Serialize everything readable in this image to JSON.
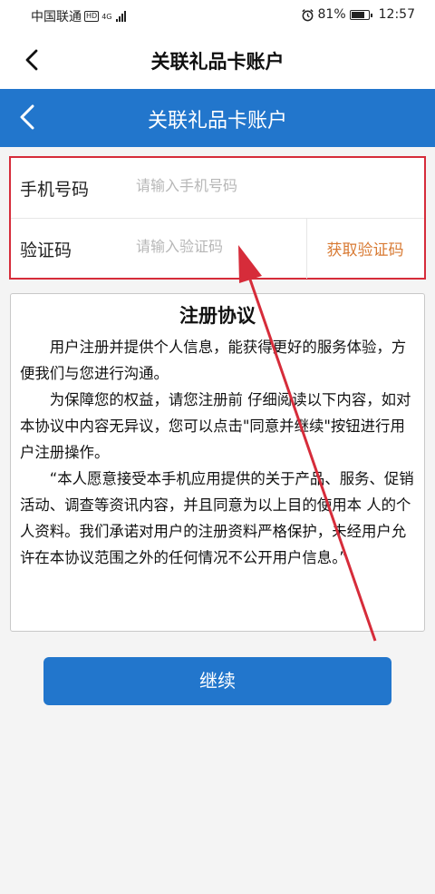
{
  "status_bar": {
    "carrier": "中国联通",
    "hd_badge": "HD",
    "network_type": "4G",
    "alarm_icon": "alarm-clock-icon",
    "battery_percent": "81%",
    "battery_level": 0.81,
    "time": "12:57"
  },
  "app_bar": {
    "title": "关联礼品卡账户",
    "back_icon": "chevron-left-icon"
  },
  "page_header": {
    "title": "关联礼品卡账户",
    "background_color": "#2276cc",
    "back_icon": "chevron-left-icon"
  },
  "form": {
    "phone_label": "手机号码",
    "phone_value": "",
    "phone_placeholder": "请输入手机号码",
    "code_label": "验证码",
    "code_value": "",
    "code_placeholder": "请输入验证码",
    "get_code_label": "获取验证码",
    "highlight_color": "#d62c3a"
  },
  "agreement": {
    "title": "注册协议",
    "paragraphs": [
      "用户注册并提供个人信息，能获得更好的服务体验，方便我们与您进行沟通。",
      "为保障您的权益，请您注册前 仔细阅读以下内容，如对本协议中内容无异议，您可以点击\"同意并继续\"按钮进行用户注册操作。",
      "“本人愿意接受本手机应用提供的关于产品、服务、促销活动、调查等资讯内容，并且同意为以上目的使用本 人的个人资料。我们承诺对用户的注册资料严格保护，未经用户允许在本协议范围之外的任何情况不公开用户信息。”"
    ]
  },
  "continue_button": {
    "label": "继续",
    "color": "#2276cc"
  },
  "annotation": {
    "arrow_color": "#d62c3a"
  }
}
